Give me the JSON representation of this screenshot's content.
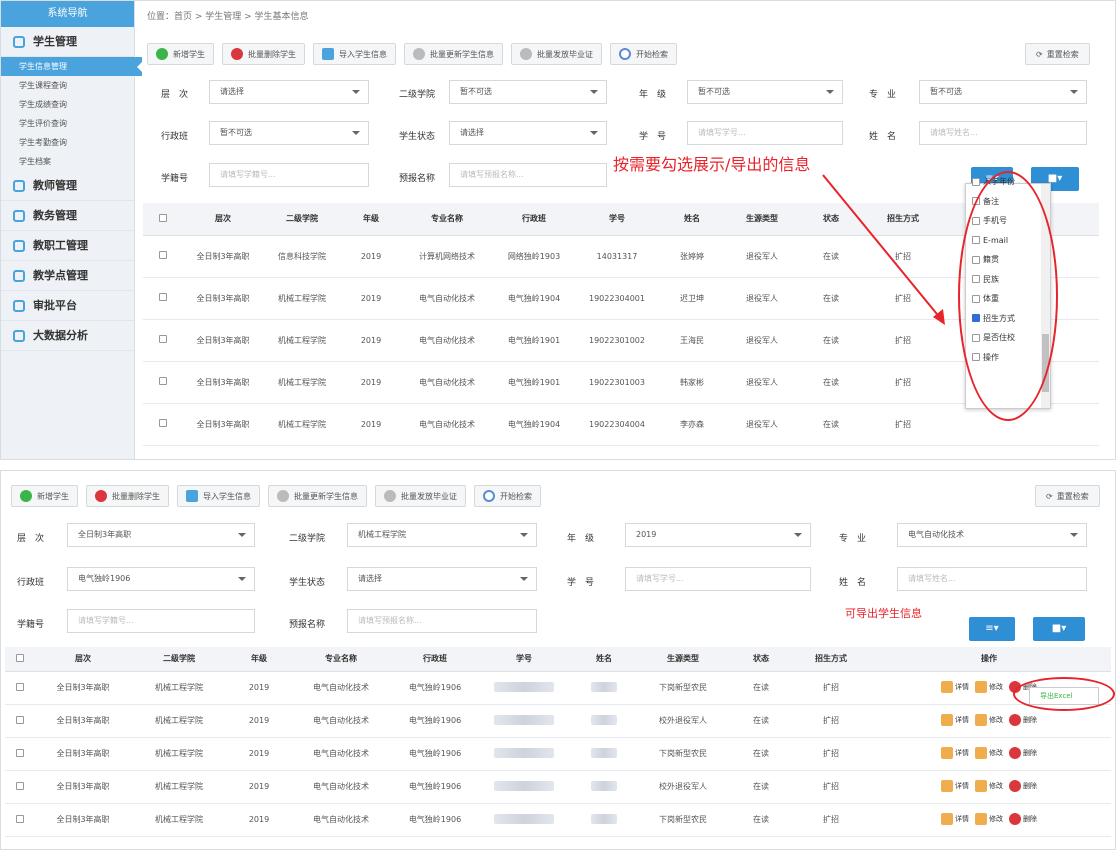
{
  "sidebar": {
    "header": "系统导航",
    "sections": [
      {
        "label": "学生管理",
        "items": [
          "学生信息管理",
          "学生课程查询",
          "学生成绩查询",
          "学生评价查询",
          "学生考勤查询",
          "学生档案"
        ]
      },
      {
        "label": "教师管理"
      },
      {
        "label": "教务管理"
      },
      {
        "label": "教职工管理"
      },
      {
        "label": "教学点管理"
      },
      {
        "label": "审批平台"
      },
      {
        "label": "大数据分析"
      }
    ]
  },
  "breadcrumb": "位置：首页 > 学生管理 > 学生基本信息",
  "toolbar": {
    "add": "新增学生",
    "batch_delete": "批量删除学生",
    "import": "导入学生信息",
    "batch_update": "批量更新学生信息",
    "batch_cert": "批量发放毕业证",
    "search": "开始检索",
    "reset": "重置检索"
  },
  "filters1": {
    "level_label": "层　次",
    "level_value": "请选择",
    "college_label": "二级学院",
    "college_value": "暂不可选",
    "grade_label": "年　级",
    "grade_value": "暂不可选",
    "major_label": "专　业",
    "major_value": "暂不可选",
    "class_label": "行政班",
    "class_value": "暂不可选",
    "status_label": "学生状态",
    "status_value": "请选择",
    "no_label": "学　号",
    "no_ph": "请填写学号...",
    "name_label": "姓　名",
    "name_ph": "请填写姓名...",
    "reg_label": "学籍号",
    "reg_ph": "请填写学籍号...",
    "pre_label": "预报名称",
    "pre_ph": "请填写预报名称..."
  },
  "filters2": {
    "level_value": "全日制3年高职",
    "college_value": "机械工程学院",
    "grade_value": "2019",
    "major_value": "电气自动化技术",
    "class_value": "电气独岭1906",
    "status_value": "请选择",
    "no_ph": "请填写学号...",
    "name_ph": "请填写姓名...",
    "reg_ph": "请填写学籍号...",
    "pre_ph": "请填写预报名称..."
  },
  "annotation1": "按需要勾选展示/导出的信息",
  "annotation2": "可导出学生信息",
  "export_excel": "导出Excel",
  "icons": {
    "list": "≡▾",
    "grid": "■▾"
  },
  "table1": {
    "headers": [
      "层次",
      "二级学院",
      "年级",
      "专业名称",
      "行政班",
      "学号",
      "姓名",
      "生源类型",
      "状态",
      "招生方式"
    ],
    "rows": [
      [
        "全日制3年高职",
        "信息科技学院",
        "2019",
        "计算机网络技术",
        "网络独岭1903",
        "14031317",
        "张婷婷",
        "退役军人",
        "在读",
        "扩招"
      ],
      [
        "全日制3年高职",
        "机械工程学院",
        "2019",
        "电气自动化技术",
        "电气独岭1904",
        "19022304001",
        "迟卫坤",
        "退役军人",
        "在读",
        "扩招"
      ],
      [
        "全日制3年高职",
        "机械工程学院",
        "2019",
        "电气自动化技术",
        "电气独岭1901",
        "19022301002",
        "王海民",
        "退役军人",
        "在读",
        "扩招"
      ],
      [
        "全日制3年高职",
        "机械工程学院",
        "2019",
        "电气自动化技术",
        "电气独岭1901",
        "19022301003",
        "韩家彬",
        "退役军人",
        "在读",
        "扩招"
      ],
      [
        "全日制3年高职",
        "机械工程学院",
        "2019",
        "电气自动化技术",
        "电气独岭1904",
        "19022304004",
        "李亦森",
        "退役军人",
        "在读",
        "扩招"
      ]
    ]
  },
  "column_menu": {
    "items": [
      "入学年份",
      "备注",
      "手机号",
      "E-mail",
      "籍贯",
      "民族",
      "体重",
      "招生方式",
      "是否住校",
      "操作"
    ],
    "checked": [
      false,
      false,
      false,
      false,
      false,
      false,
      false,
      true,
      false,
      false
    ]
  },
  "table2": {
    "headers": [
      "层次",
      "二级学院",
      "年级",
      "专业名称",
      "行政班",
      "学号",
      "姓名",
      "生源类型",
      "状态",
      "招生方式",
      "操作"
    ],
    "rows": [
      [
        "全日制3年高职",
        "机械工程学院",
        "2019",
        "电气自动化技术",
        "电气独岭1906",
        "下岗新型农民",
        "在读",
        "扩招"
      ],
      [
        "全日制3年高职",
        "机械工程学院",
        "2019",
        "电气自动化技术",
        "电气独岭1906",
        "校外退役军人",
        "在读",
        "扩招"
      ],
      [
        "全日制3年高职",
        "机械工程学院",
        "2019",
        "电气自动化技术",
        "电气独岭1906",
        "下岗新型农民",
        "在读",
        "扩招"
      ],
      [
        "全日制3年高职",
        "机械工程学院",
        "2019",
        "电气自动化技术",
        "电气独岭1906",
        "校外退役军人",
        "在读",
        "扩招"
      ],
      [
        "全日制3年高职",
        "机械工程学院",
        "2019",
        "电气自动化技术",
        "电气独岭1906",
        "下岗新型农民",
        "在读",
        "扩招"
      ]
    ],
    "actions": [
      "详情",
      "修改",
      "删除"
    ]
  },
  "colors": {
    "accent": "#4aa3dd",
    "button": "#2f8fd5",
    "annotation": "#e8232a",
    "status_green": "#39b54a"
  }
}
